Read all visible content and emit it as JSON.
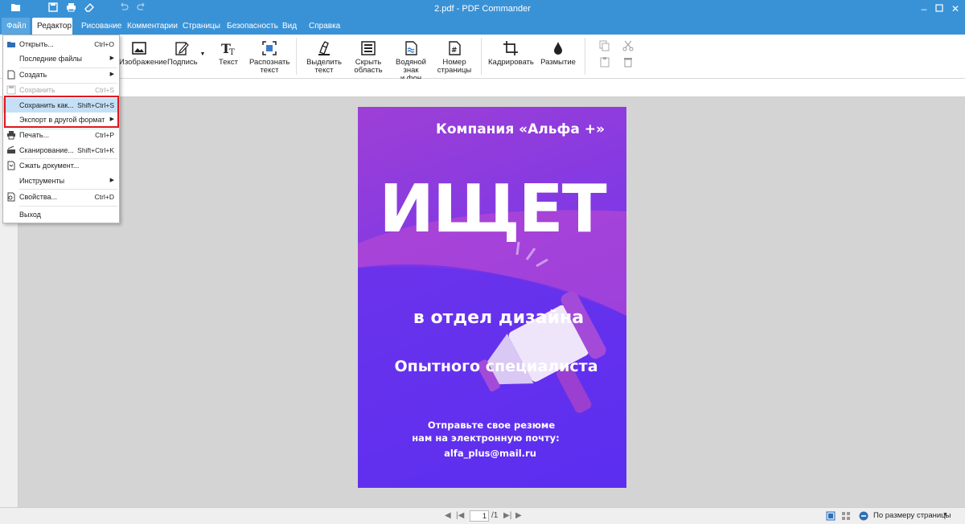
{
  "window": {
    "title": "2.pdf - PDF Commander"
  },
  "tabs": [
    {
      "label": "Файл"
    },
    {
      "label": "Редактор"
    },
    {
      "label": "Рисование"
    },
    {
      "label": "Комментарии"
    },
    {
      "label": "Страницы"
    },
    {
      "label": "Безопасность"
    },
    {
      "label": "Вид"
    },
    {
      "label": "Справка"
    }
  ],
  "ribbon": {
    "image": "Изображение",
    "signature": "Подпись",
    "text": "Текст",
    "recognize_l1": "Распознать",
    "recognize_l2": "текст",
    "highlight_l1": "Выделить",
    "highlight_l2": "текст",
    "hide_l1": "Скрыть",
    "hide_l2": "область",
    "watermark_l1": "Водяной знак",
    "watermark_l2": "и фон",
    "pagenum_l1": "Номер",
    "pagenum_l2": "страницы",
    "crop": "Кадрировать",
    "blur": "Размытие"
  },
  "file_menu": [
    {
      "label": "Открыть...",
      "shortcut": "Ctrl+O"
    },
    {
      "label": "Последние файлы"
    },
    {
      "label": "Создать"
    },
    {
      "label": "Сохранить",
      "shortcut": "Ctrl+S"
    },
    {
      "label": "Сохранить как...",
      "shortcut": "Shift+Ctrl+S"
    },
    {
      "label": "Экспорт в другой формат"
    },
    {
      "label": "Печать...",
      "shortcut": "Ctrl+P"
    },
    {
      "label": "Сканирование...",
      "shortcut": "Shift+Ctrl+K"
    },
    {
      "label": "Сжать документ..."
    },
    {
      "label": "Инструменты"
    },
    {
      "label": "Свойства...",
      "shortcut": "Ctrl+D"
    },
    {
      "label": "Выход"
    }
  ],
  "poster": {
    "company": "Компания «Альфа +»",
    "headline": "ИЩЕТ",
    "dept": "в отдел дизайна",
    "specialist": "Опытного специалиста",
    "cta_l1": "Отправьте свое резюме",
    "cta_l2": "нам на электронную почту:",
    "email": "alfa_plus@mail.ru"
  },
  "status": {
    "page": "1",
    "total": "/1",
    "zoom": "По размеру страницы"
  },
  "colors": {
    "titlebar": "#3a92d6",
    "highlight_box": "#e3151e",
    "menu_highlight": "#c5e0f6"
  }
}
